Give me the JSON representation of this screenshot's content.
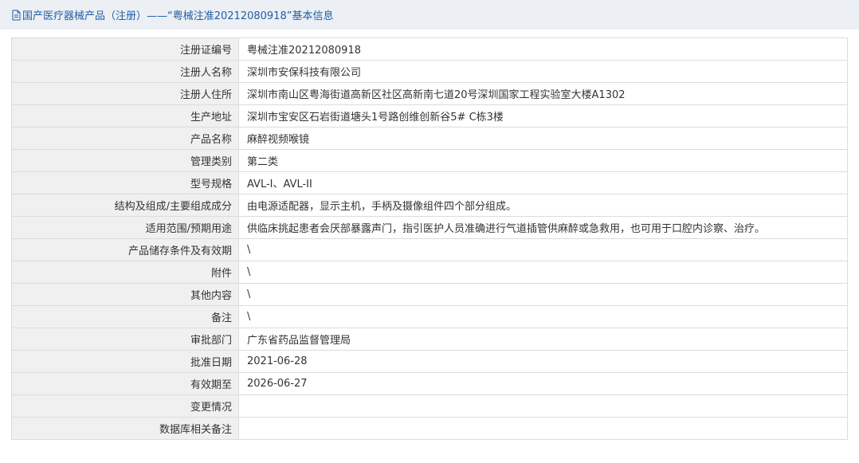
{
  "header": {
    "title": "国产医疗器械产品（注册）——“粤械注准20212080918”基本信息",
    "icon": "document-icon"
  },
  "rows": [
    {
      "label": "注册证编号",
      "value": "粤械注准20212080918"
    },
    {
      "label": "注册人名称",
      "value": "深圳市安保科技有限公司"
    },
    {
      "label": "注册人住所",
      "value": "深圳市南山区粤海街道高新区社区高新南七道20号深圳国家工程实验室大楼A1302"
    },
    {
      "label": "生产地址",
      "value": "深圳市宝安区石岩街道塘头1号路创维创新谷5# C栋3楼"
    },
    {
      "label": "产品名称",
      "value": "麻醉视频喉镜"
    },
    {
      "label": "管理类别",
      "value": "第二类"
    },
    {
      "label": "型号规格",
      "value": "AVL-I、AVL-II"
    },
    {
      "label": "结构及组成/主要组成成分",
      "value": "由电源适配器，显示主机，手柄及摄像组件四个部分组成。"
    },
    {
      "label": "适用范围/预期用途",
      "value": "供临床挑起患者会厌部暴露声门，指引医护人员准确进行气道插管供麻醉或急救用，也可用于口腔内诊察、治疗。"
    },
    {
      "label": "产品储存条件及有效期",
      "value": "\\"
    },
    {
      "label": "附件",
      "value": "\\"
    },
    {
      "label": "其他内容",
      "value": "\\"
    },
    {
      "label": "备注",
      "value": "\\"
    },
    {
      "label": "审批部门",
      "value": "广东省药品监督管理局"
    },
    {
      "label": "批准日期",
      "value": "2021-06-28"
    },
    {
      "label": "有效期至",
      "value": "2026-06-27"
    },
    {
      "label": "变更情况",
      "value": ""
    },
    {
      "label": "数据库相关备注",
      "value": ""
    }
  ],
  "colors": {
    "header_bg": "#eceff4",
    "header_text": "#1f5fa8",
    "label_bg": "#f0f0f0",
    "border": "#dcdcdc"
  }
}
